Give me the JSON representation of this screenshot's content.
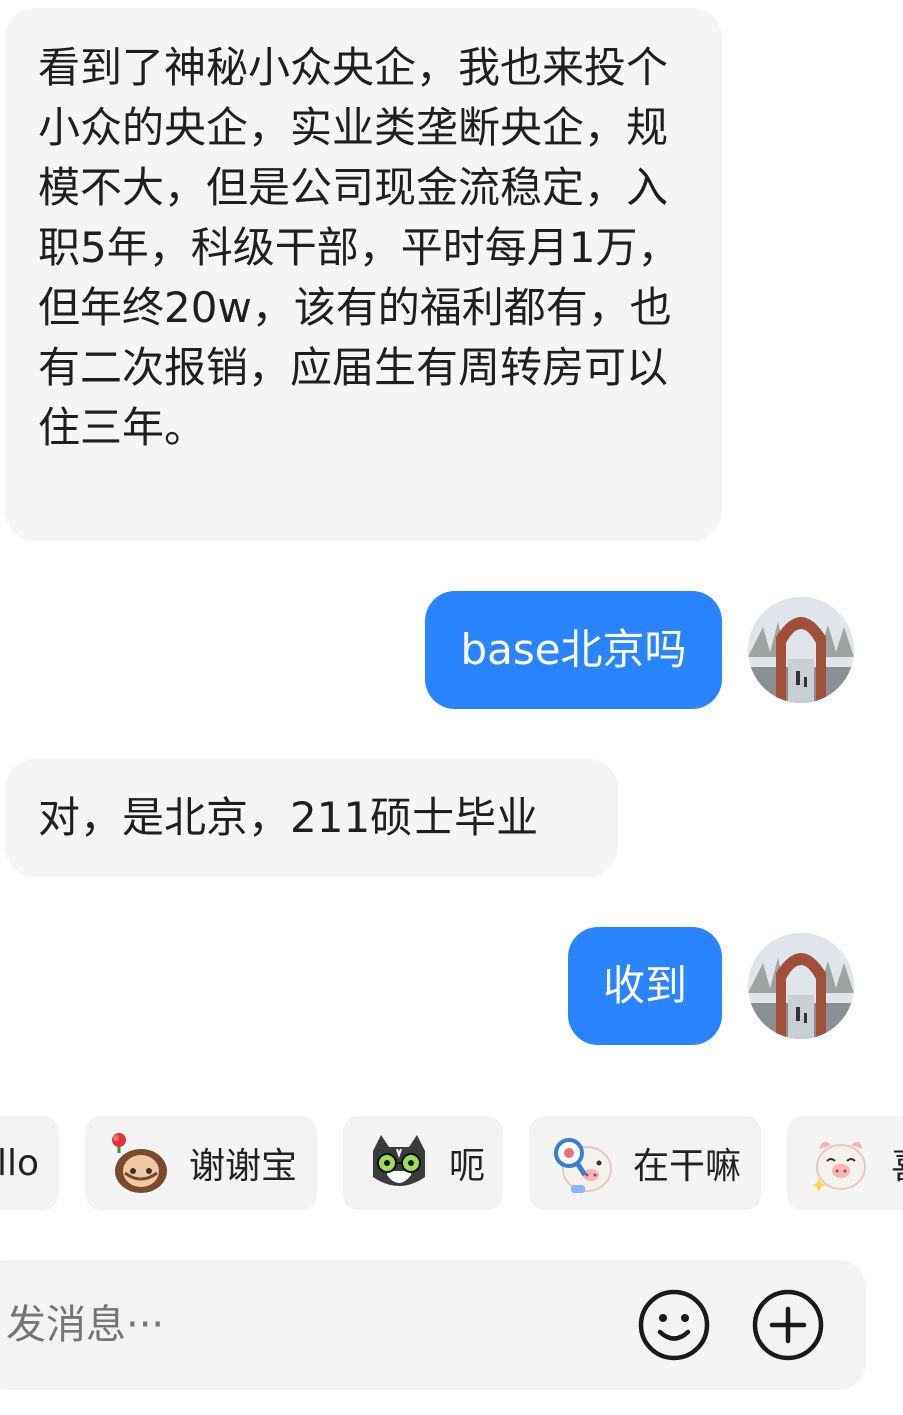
{
  "messages": [
    {
      "side": "in",
      "text": "看到了神秘小众央企，我也来投个小众的央企，实业类垄断央企，规模不大，但是公司现金流稳定，入职5年，科级干部，平时每月1万，但年终20w，该有的福利都有，也有二次报销，应届生有周转房可以住三年。"
    },
    {
      "side": "out",
      "text": "base北京吗"
    },
    {
      "side": "in",
      "text": "对，是北京，211硕士毕业"
    },
    {
      "side": "out",
      "text": "收到"
    }
  ],
  "quick_replies": [
    {
      "label": "llo",
      "icon": ""
    },
    {
      "label": "谢谢宝",
      "icon": "girl-with-rose-sticker"
    },
    {
      "label": "呃",
      "icon": "cat-with-glasses-sticker"
    },
    {
      "label": "在干嘛",
      "icon": "pig-with-magnifier-sticker"
    },
    {
      "label": "喜",
      "icon": "pig-sparkle-sticker"
    }
  ],
  "composer": {
    "placeholder": "发消息···",
    "emoji_icon": "smiley-icon",
    "plus_icon": "plus-circle-icon"
  },
  "colors": {
    "outgoing_bubble": "#2b84ff",
    "incoming_bubble": "#f5f5f5",
    "chip_background": "#f3f3f3"
  }
}
